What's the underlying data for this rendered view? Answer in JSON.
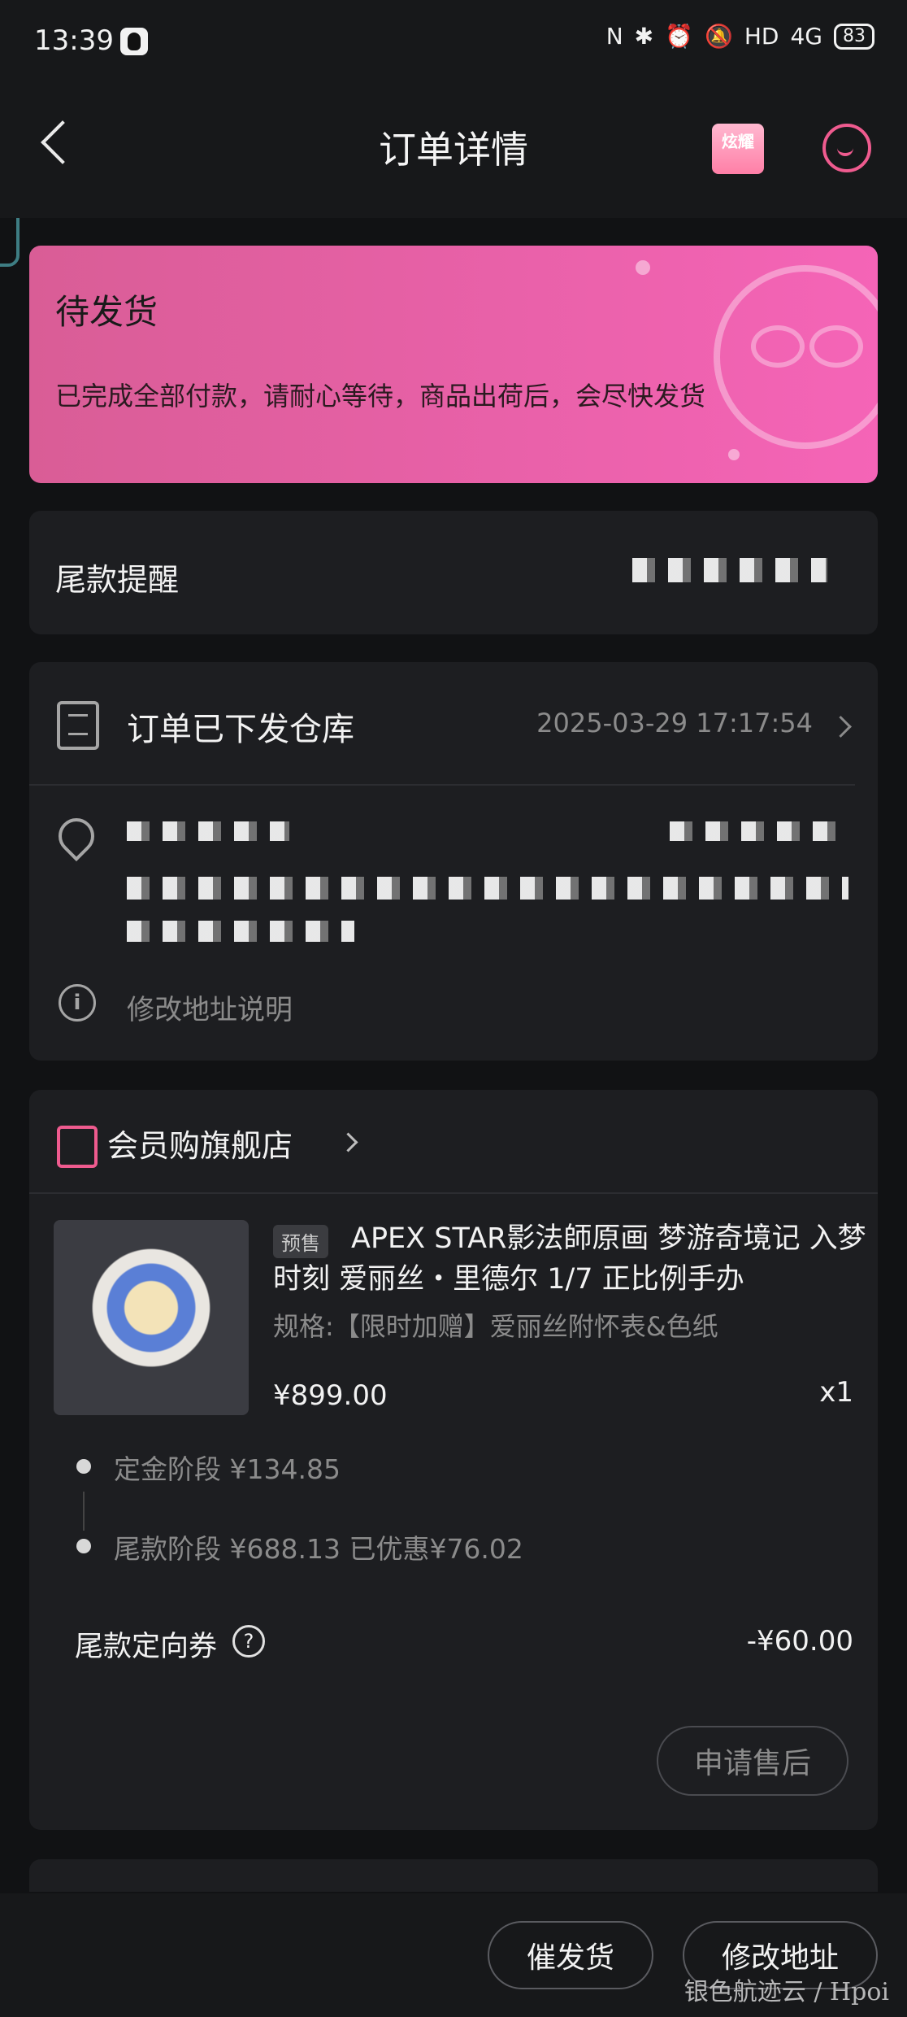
{
  "status_bar": {
    "time": "13:39",
    "nfc": "N",
    "bluetooth": "✱",
    "alarm": "⏰",
    "mute": "🔕",
    "hd": "HD",
    "network": "4G",
    "battery": "83"
  },
  "header": {
    "title": "订单详情",
    "badge_label": "炫耀"
  },
  "status_card": {
    "title": "待发货",
    "description": "已完成全部付款，请耐心等待，商品出荷后，会尽快发货"
  },
  "reminder": {
    "label": "尾款提醒"
  },
  "shipping": {
    "title": "订单已下发仓库",
    "time": "2025-03-29 17:17:54",
    "address_note": "修改地址说明"
  },
  "store": {
    "name": "会员购旗舰店"
  },
  "product": {
    "tag": "预售",
    "title": "APEX STAR影法師原画 梦游奇境记 入梦时刻 爱丽丝・里德尔 1/7 正比例手办",
    "spec": "规格:【限时加赠】爱丽丝附怀表&色纸",
    "price": "¥899.00",
    "qty": "x1"
  },
  "payment_stages": [
    {
      "text": "定金阶段  ¥134.85"
    },
    {
      "text": "尾款阶段  ¥688.13  已优惠¥76.02"
    }
  ],
  "coupon": {
    "label": "尾款定向券",
    "help_icon": "?",
    "value": "-¥60.00"
  },
  "buttons": {
    "aftersale": "申请售后",
    "urge": "催发货",
    "change_address": "修改地址"
  },
  "watermark": "银色航迹云 / Hpoi",
  "colors": {
    "accent": "#ef5b8f",
    "banner_start": "#d95d96",
    "banner_end": "#f564b7",
    "background": "#111214",
    "card": "#1d1e21"
  },
  "icons": [
    "back-icon",
    "badge-icon",
    "customer-service-icon",
    "document-icon",
    "location-pin-icon",
    "info-icon",
    "shop-bag-icon",
    "help-icon"
  ]
}
